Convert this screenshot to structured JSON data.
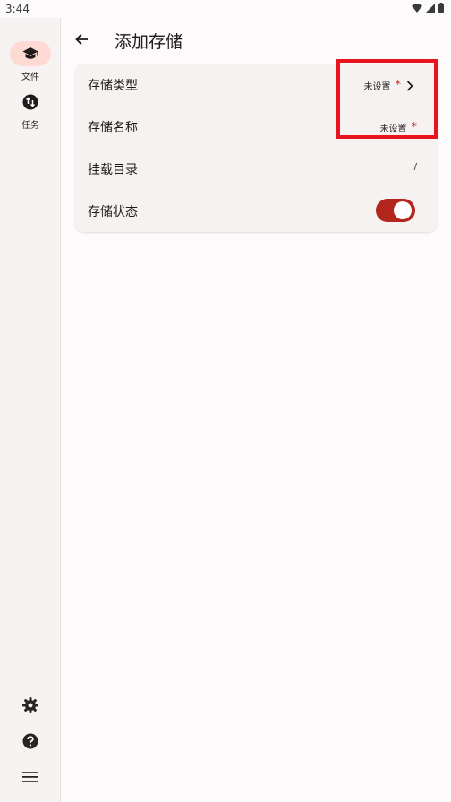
{
  "status": {
    "time": "3:44"
  },
  "rail": {
    "items": [
      {
        "label": "文件",
        "icon": "graduation-cap-icon"
      },
      {
        "label": "任务",
        "icon": "sync-circle-icon"
      }
    ],
    "bottom": [
      "settings-icon",
      "help-icon",
      "menu-icon"
    ]
  },
  "appbar": {
    "title": "添加存储"
  },
  "form": {
    "rows": [
      {
        "label": "存储类型",
        "value": "未设置",
        "required": "*"
      },
      {
        "label": "存储名称",
        "value": "未设置",
        "required": "*"
      },
      {
        "label": "挂载目录",
        "value": "/"
      },
      {
        "label": "存储状态",
        "toggle_on": true
      }
    ]
  },
  "colors": {
    "accent": "#b3261e",
    "highlight": "#e8151f",
    "active_pill": "#ffdad5"
  }
}
